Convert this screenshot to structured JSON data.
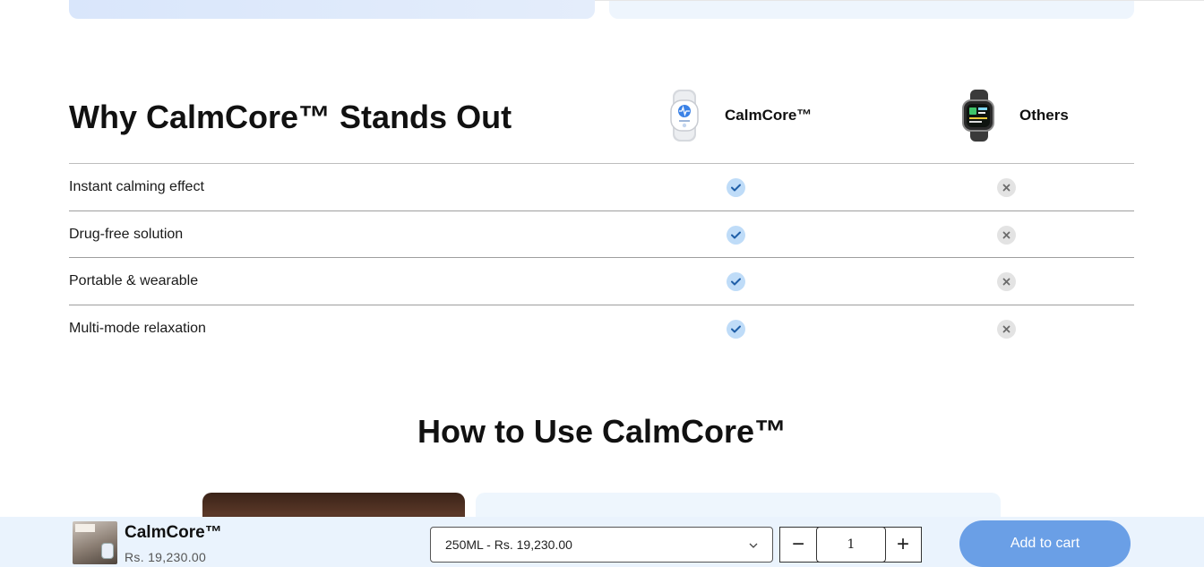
{
  "comparison": {
    "title": "Why CalmCore™ Stands Out",
    "columns": [
      {
        "name": "CalmCore™",
        "icon": "calmcore-device-icon"
      },
      {
        "name": "Others",
        "icon": "smartwatch-icon"
      }
    ],
    "rows": [
      {
        "label": "Instant calming effect",
        "calmcore": true,
        "others": false
      },
      {
        "label": "Drug-free solution",
        "calmcore": true,
        "others": false
      },
      {
        "label": "Portable & wearable",
        "calmcore": true,
        "others": false
      },
      {
        "label": "Multi-mode relaxation",
        "calmcore": true,
        "others": false
      }
    ]
  },
  "how_to": {
    "title": "How to Use CalmCore™"
  },
  "sticky_cart": {
    "product_name": "CalmCore™",
    "price": "Rs. 19,230.00",
    "variant_selected": "250ML - Rs. 19,230.00",
    "quantity": "1",
    "minus_symbol": "−",
    "plus_symbol": "+",
    "add_to_cart_label": "Add to cart"
  },
  "colors": {
    "accent_button": "#6a9fe6",
    "check_bg": "#bfdcf8",
    "check_mark": "#1f5fa8",
    "cross_bg": "#e3e3e3",
    "sticky_bg": "#eaf3fd"
  }
}
